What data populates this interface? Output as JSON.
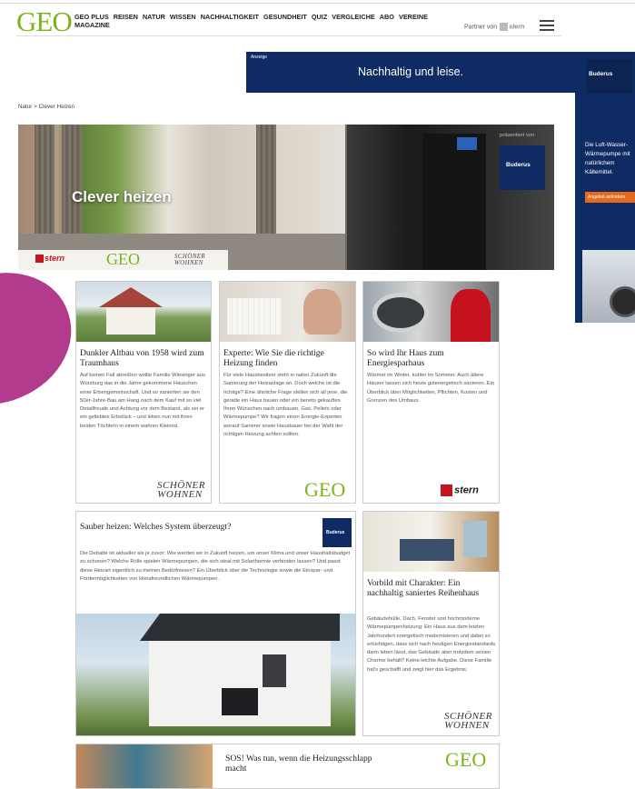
{
  "header": {
    "logo": "GEO",
    "nav": [
      "GEO PLUS",
      "REISEN",
      "NATUR",
      "WISSEN",
      "NACHHALTIGKEIT",
      "GESUNDHEIT",
      "QUIZ",
      "VERGLEICHE",
      "ABO",
      "VEREINE"
    ],
    "nav_sub": "MAGAZINE",
    "partner_label": "Partner von",
    "partner_brand": "stern"
  },
  "ads": {
    "top_label": "Anzeige",
    "top_text": "Nachhaltig und leise.",
    "side_brand": "Buderus",
    "side_text": "Die Luft-Wasser-Wärmepumpe mit natürlichem Kältemittel.",
    "side_cta": "Angebot anfordern"
  },
  "breadcrumb": "Natur > Clever Heizen",
  "hero": {
    "title": "Clever heizen",
    "presented_by": "präsentiert von",
    "sponsor": "Buderus",
    "partner_stern": "stern",
    "partner_geo": "GEO",
    "partner_sw": "SCHÖNER WOHNEN"
  },
  "cards": [
    {
      "title": "Dunkler Altbau von 1958 wird zum Traumhaus",
      "text": "Auf keinen Fall abreißen wollte Familie Wiesinger aus Würzburg das in die Jahre gekommene Häuschen einer Erbengemeinschaft. Und so sanierten sie den 50er-Jahre-Bau am Hang nach dem Kauf mit so viel Detailfreude und Achtung vor dem Bestand, als sei er ein geliebtes Erbstück – und leben nun mit ihren beiden Töchtern in einem wahren Kleinod.",
      "source": "SCHÖNER WOHNEN"
    },
    {
      "title": "Experte: Wie Sie die richtige Heizung finden",
      "text": "Für viele Hausbesitzer steht in naher Zukunft die Sanierung der Heizanlage an. Doch welche ist die richtige? Eine ähnliche Frage stellen sich all jene, die gerade ein Haus bauen oder ein bereits gekauftes Ihren Wünschen nach umbauen. Gas, Pellets oder Wärmepumpe? Wir fragen einen Energie-Experten worauf Sanierer sowie Hausbauer bei der Wahl der richtigen Heizung achten sollten.",
      "source": "GEO"
    },
    {
      "title": "So wird Ihr Haus zum Energiesparhaus",
      "text": "Wärmer im Winter, kühler im Sommer. Auch ältere Häuser lassen sich heute gutenergetisch sanieren. Ein Überblick über Möglichkeiten, Pflichten, Kosten und Grenzen des Umbaus.",
      "source": "stern"
    },
    {
      "title": "Sauber heizen: Welches System überzeugt?",
      "text": "Die Debatte ist aktueller als je zuvor: Wie werden wir in Zukunft heizen, um unser Klima und unser Haushaltsbudget zu schonen? Welche Rolle spielen Wärmepumpen, die sich ideal mit Solarthermie verbinden lassen? Und passt diese Heizart eigentlich zu meinen Bedürfnissen? Ein Überblick über die Technologie sowie die Einspar- und Fördermöglichkeiten von klimafreundlichen Wärmepumpen.",
      "source": "Buderus"
    },
    {
      "title": "Vorbild mit Charakter: Ein nachhaltig saniertes Reihenhaus",
      "text": "Gebäudehülle, Dach, Fenster und hochmoderne Wärmepumpenheizung: Ein Haus aus dem letzten Jahrhundert energetisch modernisieren und dabei so ertüchtigen, dass sich nach heutigen Energiestandards darin leben lässt, das Gebäude aber trotzdem seinen Charme behält? Keine leichte Aufgabe. Diese Familie hat's geschafft und zeigt hier das Ergebnis.",
      "source": "SCHÖNER WOHNEN"
    },
    {
      "title": "SOS! Was tun, wenn die Heizungsschlapp macht",
      "source": "GEO"
    }
  ]
}
